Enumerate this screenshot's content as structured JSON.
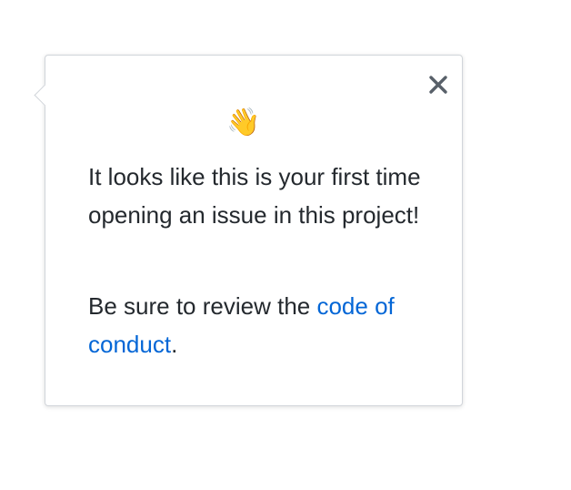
{
  "popover": {
    "emoji": "👋",
    "emoji_icon": "waving-hand-icon",
    "close_icon": "close-icon",
    "message": "It looks like this is your first time opening an issue in this project!",
    "review_prefix": "Be sure to review the ",
    "review_link": "code of conduct",
    "review_suffix": "."
  },
  "colors": {
    "text": "#24292e",
    "link": "#0366d6",
    "close_icon": "#586069",
    "border": "#d1d5da"
  }
}
